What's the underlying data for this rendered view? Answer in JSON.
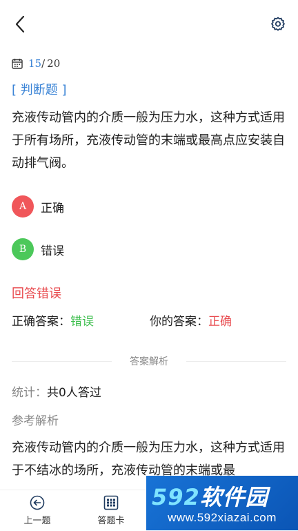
{
  "progress": {
    "current": "15",
    "separator": "/",
    "total": "20"
  },
  "question": {
    "type_label": "[ 判断题 ]",
    "text": "充液传动管内的介质一般为压力水，这种方式适用于所有场所，充液传动管的末端或最高点应安装自动排气阀。"
  },
  "options": [
    {
      "letter": "A",
      "label": "正确",
      "color": "#f0565a"
    },
    {
      "letter": "B",
      "label": "错误",
      "color": "#4cc85a"
    }
  ],
  "result": {
    "status_text": "回答错误",
    "correct_label": "正确答案：",
    "correct_value": "错误",
    "your_label": "你的答案：",
    "your_value": "正确"
  },
  "analysis": {
    "divider_label": "答案解析",
    "stats_label": "统计：",
    "stats_value": "共0人答过",
    "ref_title": "参考解析",
    "text": "充液传动管内的介质一般为压力水，这种方式适用于不结冰的场所，充液传动管的末端或最"
  },
  "bottom_nav": {
    "prev_label": "上一题",
    "card_label": "答题卡"
  },
  "watermark": {
    "logo_num": "592",
    "logo_text": "软件园",
    "url": "www.592xiazai.com"
  },
  "colors": {
    "accent": "#3b84d6",
    "error": "#e84a4e",
    "success": "#3fbf4f"
  }
}
